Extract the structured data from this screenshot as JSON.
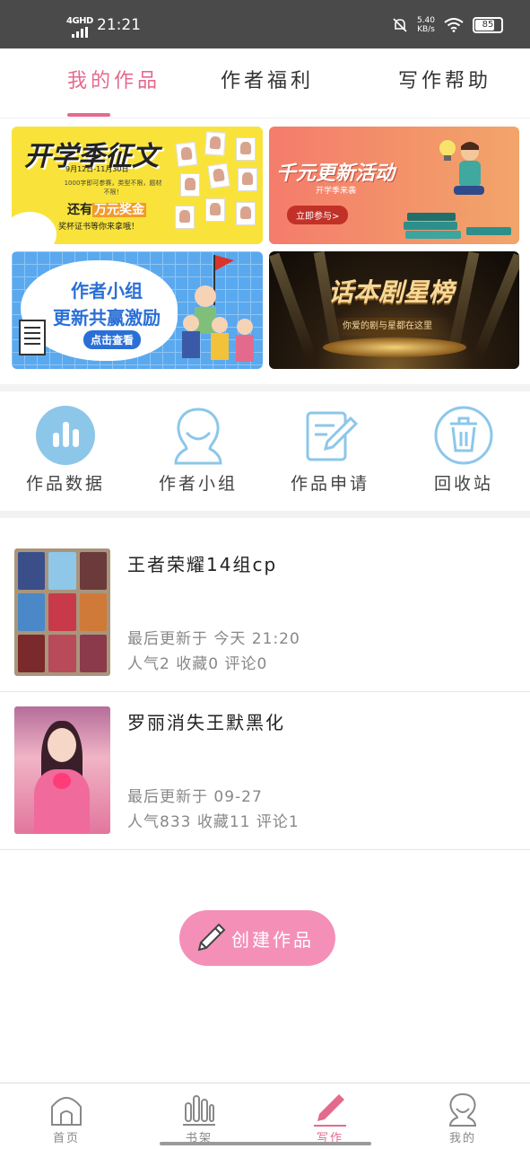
{
  "status_bar": {
    "network": "4GHD",
    "time": "21:21",
    "speed_value": "5.40",
    "speed_unit": "KB/s",
    "battery": "85"
  },
  "tabs": [
    {
      "label": "我的作品",
      "active": true
    },
    {
      "label": "作者福利",
      "active": false
    },
    {
      "label": "写作帮助",
      "active": false
    }
  ],
  "banners": {
    "essay": {
      "title": "开学季征文",
      "date": "9月12日-11月30日",
      "desc": "1000字即可参赛，类型不限，题材不限！",
      "prize_prefix": "还有",
      "prize_highlight": "万元奖金",
      "cert": "奖杯证书等你来拿哦！"
    },
    "update": {
      "title": "千元更新活动",
      "subtitle": "开学季来袭",
      "button": "立即参与>"
    },
    "group": {
      "line1": "作者小组",
      "line2": "更新共赢激励",
      "button": "点击查看"
    },
    "script_chart": {
      "title": "话本剧星榜",
      "subtitle": "你爱的剧与星都在这里"
    }
  },
  "quick_actions": [
    {
      "label": "作品数据",
      "icon": "bar-chart-icon"
    },
    {
      "label": "作者小组",
      "icon": "group-person-icon"
    },
    {
      "label": "作品申请",
      "icon": "edit-document-icon"
    },
    {
      "label": "回收站",
      "icon": "trash-icon"
    }
  ],
  "works": [
    {
      "title": "王者荣耀14组cp",
      "updated": "最后更新于 今天 21:20",
      "stats": "人气2 收藏0 评论0"
    },
    {
      "title": "罗丽消失王默黑化",
      "updated": "最后更新于 09-27",
      "stats": "人气833 收藏11 评论1"
    }
  ],
  "create_button": {
    "label": "创建作品"
  },
  "bottom_nav": [
    {
      "label": "首页",
      "icon": "home-icon",
      "active": false
    },
    {
      "label": "书架",
      "icon": "bookshelf-icon",
      "active": false
    },
    {
      "label": "写作",
      "icon": "pen-icon",
      "active": true
    },
    {
      "label": "我的",
      "icon": "profile-icon",
      "active": false
    }
  ],
  "colors": {
    "accent": "#e46a8d",
    "icon_blue": "#8cc7ea",
    "create_button": "#f490b8"
  }
}
